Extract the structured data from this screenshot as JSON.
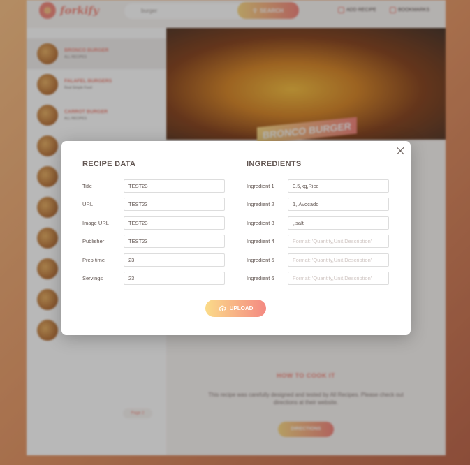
{
  "app": {
    "brand": "forkify",
    "search_placeholder": "burger",
    "search_button": "SEARCH",
    "nav": {
      "add_recipe": "ADD RECIPE",
      "bookmarks": "BOOKMARKS"
    },
    "results": [
      {
        "title": "BRONCO BURGER",
        "publisher": "ALL RECIPES"
      },
      {
        "title": "FALAFEL BURGERS",
        "publisher": "Real Simple Food"
      },
      {
        "title": "CARROT BURGER",
        "publisher": "ALL RECIPES"
      },
      {
        "title": "",
        "publisher": ""
      },
      {
        "title": "",
        "publisher": ""
      },
      {
        "title": "",
        "publisher": ""
      },
      {
        "title": "",
        "publisher": ""
      },
      {
        "title": "",
        "publisher": ""
      },
      {
        "title": "",
        "publisher": ""
      },
      {
        "title": "",
        "publisher": ""
      }
    ],
    "pager": "Page 2",
    "recipe_title": "BRONCO BURGER",
    "howto_title": "HOW TO COOK IT",
    "howto_text": "This recipe was carefully designed and tested by All Recipes. Please check out directions at their website.",
    "howto_button": "DIRECTIONS"
  },
  "modal": {
    "recipe_heading": "RECIPE DATA",
    "ingredients_heading": "INGREDIENTS",
    "recipe_fields": [
      {
        "label": "Title",
        "value": "TEST23"
      },
      {
        "label": "URL",
        "value": "TEST23"
      },
      {
        "label": "Image URL",
        "value": "TEST23"
      },
      {
        "label": "Publisher",
        "value": "TEST23"
      },
      {
        "label": "Prep time",
        "value": "23"
      },
      {
        "label": "Servings",
        "value": "23"
      }
    ],
    "ingredient_fields": [
      {
        "label": "Ingredient 1",
        "value": "0.5,kg,Rice",
        "placeholder": "Format: 'Quantity,Unit,Description'"
      },
      {
        "label": "Ingredient 2",
        "value": "1,,Avocado",
        "placeholder": "Format: 'Quantity,Unit,Description'"
      },
      {
        "label": "Ingredient 3",
        "value": ",,salt",
        "placeholder": "Format: 'Quantity,Unit,Description'"
      },
      {
        "label": "Ingredient 4",
        "value": "",
        "placeholder": "Format: 'Quantity,Unit,Description'"
      },
      {
        "label": "Ingredient 5",
        "value": "",
        "placeholder": "Format: 'Quantity,Unit,Description'"
      },
      {
        "label": "Ingredient 6",
        "value": "",
        "placeholder": "Format: 'Quantity,Unit,Description'"
      }
    ],
    "upload_label": "UPLOAD",
    "colors": {
      "accent_start": "#fbdb89",
      "accent_end": "#f48982",
      "text": "#615551"
    }
  }
}
